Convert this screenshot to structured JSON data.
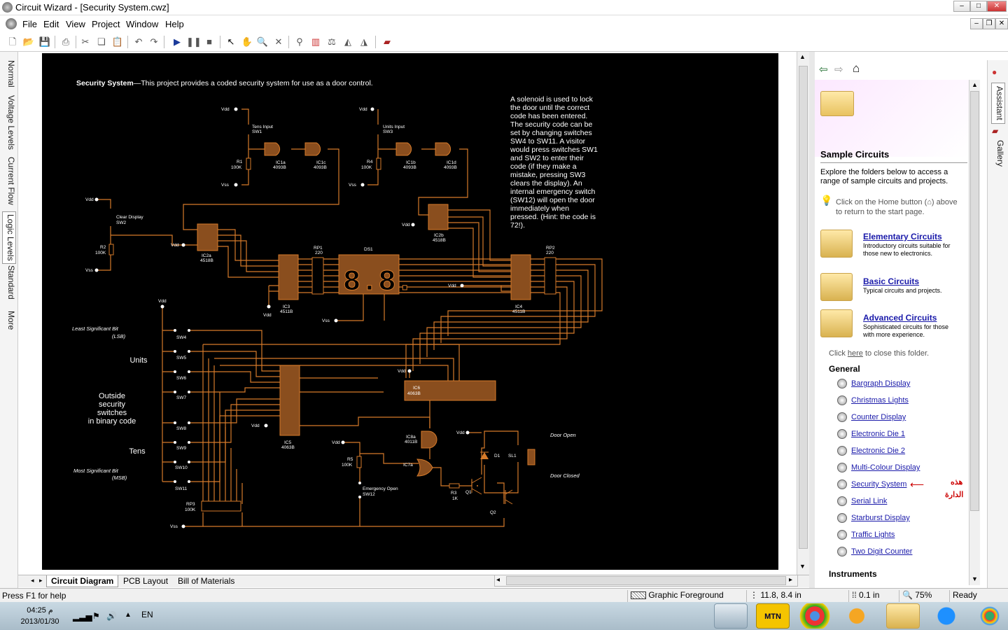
{
  "app": {
    "title": "Circuit Wizard - [Security System.cwz]"
  },
  "menu": [
    "File",
    "Edit",
    "View",
    "Project",
    "Window",
    "Help"
  ],
  "left_tabs": [
    "Normal",
    "Voltage Levels",
    "Current Flow",
    "Logic Levels",
    "Standard",
    "More"
  ],
  "circuit": {
    "heading_bold": "Security System",
    "heading_rest": "—This project provides a coded security system for use as a door control.",
    "description": [
      "A solenoid is used to lock",
      "the door until the correct",
      "code has been entered.",
      "The security code can be",
      "set by changing switches",
      "SW4 to SW11. A visitor",
      "would press switches SW1",
      "and SW2 to enter their",
      "code (if they make a",
      "mistake, pressing SW3",
      "clears the display). An",
      "internal emergency switch",
      "(SW12) will open the door",
      "immediately when",
      "pressed. (Hint: the code is",
      "72!)."
    ],
    "labels": {
      "units": "Units",
      "outside": [
        "Outside",
        "security",
        "switches",
        "in binary code"
      ],
      "tens": "Tens",
      "lsb": [
        "Least Significant Bit",
        "(LSB)"
      ],
      "msb": [
        "Most Significant Bit",
        "(MSB)"
      ],
      "door_open": "Door Open",
      "door_closed": "Door Closed"
    }
  },
  "bottom_tabs": [
    "Circuit Diagram",
    "PCB Layout",
    "Bill of Materials"
  ],
  "assistant": {
    "heading": "Sample Circuits",
    "intro": "Explore the folders below to access a range of sample circuits and projects.",
    "tip_a": "Click on the Home button (",
    "tip_b": ") above",
    "tip_c": "to return to the start page.",
    "folders": [
      {
        "title": "Elementary Circuits",
        "desc1": "Introductory circuits suitable for",
        "desc2": "those new to electronics."
      },
      {
        "title": "Basic Circuits",
        "desc1": "Typical circuits and projects.",
        "desc2": ""
      },
      {
        "title": "Advanced Circuits",
        "desc1": "Sophisticated circuits for those",
        "desc2": "with more experience."
      }
    ],
    "close_a": "Click ",
    "close_link": "here",
    "close_b": " to close this folder.",
    "general_heading": "General",
    "general_items": [
      "Bargraph Display",
      "Christmas Lights",
      "Counter Display",
      "Electronic Die 1",
      "Electronic Die 2",
      "Multi-Colour Display",
      "Security System",
      "Serial Link",
      "Starburst Display",
      "Traffic Lights",
      "Two Digit Counter"
    ],
    "instruments_heading": "Instruments",
    "annotation": [
      "هذه",
      "الدارة"
    ]
  },
  "right_tabs": [
    "Assistant",
    "Gallery"
  ],
  "status": {
    "help": "Press F1 for help",
    "layer": "Graphic Foreground",
    "coords": "11.8, 8.4 in",
    "grid": "0.1 in",
    "zoom": "75%",
    "state": "Ready"
  },
  "taskbar": {
    "time": "04:25 م",
    "date": "2013/01/30",
    "lang": "EN",
    "mtn": "MTN"
  },
  "colors": {
    "wire": "#d57a2a",
    "ic": "#8a4e1e",
    "label": "#ffffff",
    "annotation": "#cc0000"
  }
}
